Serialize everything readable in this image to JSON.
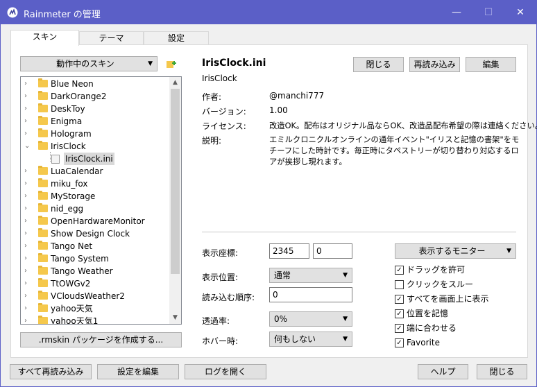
{
  "window": {
    "title": "Rainmeter の管理",
    "min_glyph": "—",
    "max_glyph": "☐",
    "close_glyph": "✕"
  },
  "tabs": [
    {
      "label": "スキン"
    },
    {
      "label": "テーマ"
    },
    {
      "label": "設定"
    }
  ],
  "skins_dropdown": {
    "label": "動作中のスキン"
  },
  "tree": {
    "items": [
      {
        "label": "Blue Neon"
      },
      {
        "label": "DarkOrange2"
      },
      {
        "label": "DeskToy"
      },
      {
        "label": "Enigma"
      },
      {
        "label": "Hologram"
      },
      {
        "label": "IrisClock",
        "expanded": true
      },
      {
        "label": "IrisClock.ini",
        "child": true
      },
      {
        "label": "LuaCalendar"
      },
      {
        "label": "miku_fox"
      },
      {
        "label": "MyStorage"
      },
      {
        "label": "nid_egg"
      },
      {
        "label": "OpenHardwareMonitor"
      },
      {
        "label": "Show Design Clock"
      },
      {
        "label": "Tango Net"
      },
      {
        "label": "Tango System"
      },
      {
        "label": "Tango Weather"
      },
      {
        "label": "TtOWGv2"
      },
      {
        "label": "VCloudsWeather2"
      },
      {
        "label": "yahoo天気"
      },
      {
        "label": "yahoo天気1"
      }
    ]
  },
  "create_package_button": ".rmskin パッケージを作成する...",
  "skin": {
    "title": "IrisClock.ini",
    "folder": "IrisClock",
    "close_button": "閉じる",
    "refresh_button": "再読み込み",
    "edit_button": "編集",
    "author_label": "作者:",
    "author": "@manchi777",
    "version_label": "バージョン:",
    "version": "1.00",
    "license_label": "ライセンス:",
    "license": "改造OK。配布はオリジナル品ならOK、改造品配布希望の際は連絡ください。",
    "desc_label": "説明:",
    "description": "エミルクロニクルオンラインの通年イベント\"イリスと記憶の書架\"をモチーフにした時計です。毎正時にタペストリーが切り替わり対応するロアが挨拶し現れます。"
  },
  "settings": {
    "coords_label": "表示座標:",
    "coord_x": "2345",
    "coord_y": "0",
    "position_label": "表示位置:",
    "position_value": "通常",
    "load_order_label": "読み込む順序:",
    "load_order_value": "0",
    "transparency_label": "透過率:",
    "transparency_value": "0%",
    "hover_label": "ホバー時:",
    "hover_value": "何もしない",
    "monitor_button": "表示するモニター",
    "checkboxes": [
      {
        "label": "ドラッグを許可",
        "checked": true
      },
      {
        "label": "クリックをスルー",
        "checked": false
      },
      {
        "label": "すべてを画面上に表示",
        "checked": true
      },
      {
        "label": "位置を記憶",
        "checked": true
      },
      {
        "label": "端に合わせる",
        "checked": true
      },
      {
        "label": "Favorite",
        "checked": true
      }
    ]
  },
  "footer": {
    "refresh_all": "すべて再読み込み",
    "edit_settings": "設定を編集",
    "open_log": "ログを開く",
    "help": "ヘルプ",
    "close": "閉じる"
  },
  "colors": {
    "titlebar": "#5b5fc7",
    "folder": "#f5c84c"
  }
}
